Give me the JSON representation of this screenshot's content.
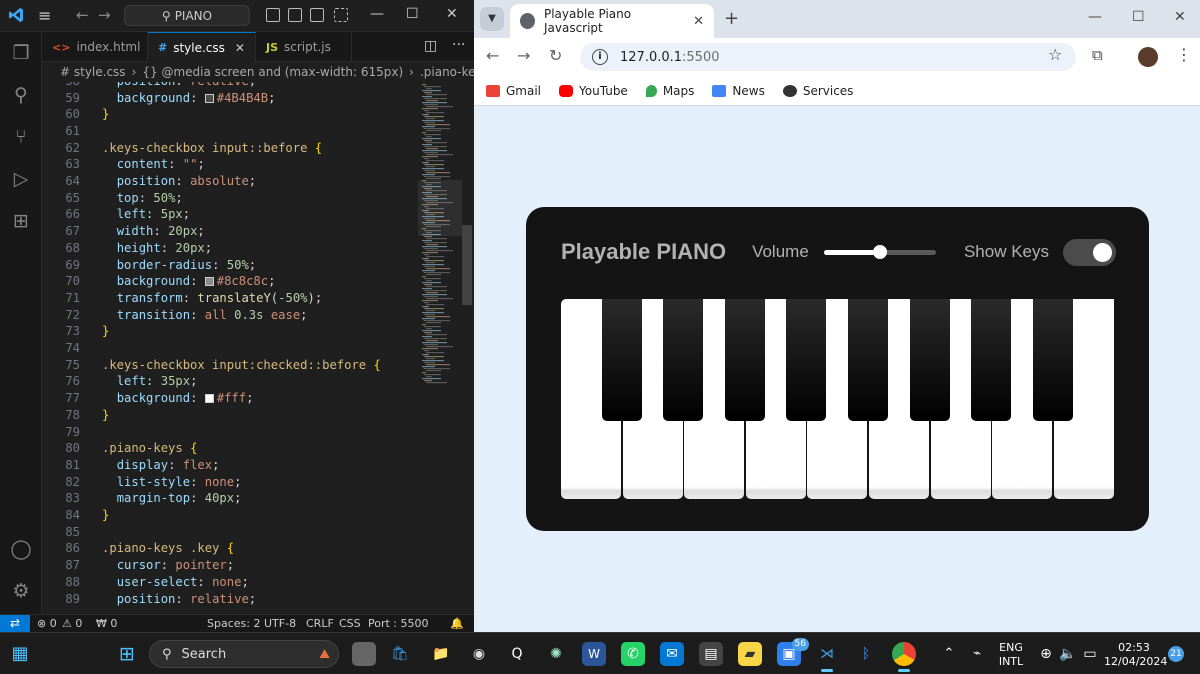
{
  "vscode": {
    "command_center": "PIANO",
    "tabs": [
      {
        "label": "index.html",
        "icon": "<>",
        "icon_color": "#e44d26"
      },
      {
        "label": "style.css",
        "icon": "#",
        "icon_color": "#42a5f5"
      },
      {
        "label": "script.js",
        "icon": "JS",
        "icon_color": "#cbcb41"
      }
    ],
    "breadcrumb": [
      "# style.css",
      "{} @media screen and (max-width: 615px)",
      ".piano-keys .key:nth"
    ],
    "status": {
      "remote": "⇄",
      "errors": "⊗ 0",
      "warnings": "⚠ 0",
      "ports": "₩ 0",
      "spaces": "Spaces: 2",
      "encoding": "UTF-8",
      "eol": "CRLF",
      "language": "CSS",
      "port": "Port : 5500",
      "bell": "🔔"
    }
  },
  "code_lines": [
    {
      "n": "59",
      "html": "  <span class='prop'>background</span>: <span class='cswatch' style='background:#4B4B4B'></span><span class='val'>#4B4B4B</span>;"
    },
    {
      "n": "60",
      "html": "<span class='br'>}</span>"
    },
    {
      "n": "61",
      "html": ""
    },
    {
      "n": "62",
      "html": "<span class='sel'>.keys-checkbox input::before</span> <span class='br'>{</span>"
    },
    {
      "n": "63",
      "html": "  <span class='prop'>content</span>: <span class='val'>\"\"</span>;"
    },
    {
      "n": "64",
      "html": "  <span class='prop'>position</span>: <span class='val'>absolute</span>;"
    },
    {
      "n": "65",
      "html": "  <span class='prop'>top</span>: <span class='num'>50%</span>;"
    },
    {
      "n": "66",
      "html": "  <span class='prop'>left</span>: <span class='num'>5px</span>;"
    },
    {
      "n": "67",
      "html": "  <span class='prop'>width</span>: <span class='num'>20px</span>;"
    },
    {
      "n": "68",
      "html": "  <span class='prop'>height</span>: <span class='num'>20px</span>;"
    },
    {
      "n": "69",
      "html": "  <span class='prop'>border-radius</span>: <span class='num'>50%</span>;"
    },
    {
      "n": "70",
      "html": "  <span class='prop'>background</span>: <span class='cswatch' style='background:#8c8c8c'></span><span class='val'>#8c8c8c</span>;"
    },
    {
      "n": "71",
      "html": "  <span class='prop'>transform</span>: <span class='fn'>translateY</span>(<span class='num'>-50%</span>);"
    },
    {
      "n": "72",
      "html": "  <span class='prop'>transition</span>: <span class='val'>all</span> <span class='num'>0.3s</span> <span class='val'>ease</span>;"
    },
    {
      "n": "73",
      "html": "<span class='br'>}</span>"
    },
    {
      "n": "74",
      "html": ""
    },
    {
      "n": "75",
      "html": "<span class='sel'>.keys-checkbox input:checked::before</span> <span class='br'>{</span>"
    },
    {
      "n": "76",
      "html": "  <span class='prop'>left</span>: <span class='num'>35px</span>;"
    },
    {
      "n": "77",
      "html": "  <span class='prop'>background</span>: <span class='cswatch' style='background:#fff'></span><span class='val'>#fff</span>;"
    },
    {
      "n": "78",
      "html": "<span class='br'>}</span>"
    },
    {
      "n": "79",
      "html": ""
    },
    {
      "n": "80",
      "html": "<span class='sel'>.piano-keys</span> <span class='br'>{</span>"
    },
    {
      "n": "81",
      "html": "  <span class='prop'>display</span>: <span class='val'>flex</span>;"
    },
    {
      "n": "82",
      "html": "  <span class='prop'>list-style</span>: <span class='val'>none</span>;"
    },
    {
      "n": "83",
      "html": "  <span class='prop'>margin-top</span>: <span class='num'>40px</span>;"
    },
    {
      "n": "84",
      "html": "<span class='br'>}</span>"
    },
    {
      "n": "85",
      "html": ""
    },
    {
      "n": "86",
      "html": "<span class='sel'>.piano-keys .key</span> <span class='br'>{</span>"
    },
    {
      "n": "87",
      "html": "  <span class='prop'>cursor</span>: <span class='val'>pointer</span>;"
    },
    {
      "n": "88",
      "html": "  <span class='prop'>user-select</span>: <span class='val'>none</span>;"
    },
    {
      "n": "89",
      "html": "  <span class='prop'>position</span>: <span class='val'>relative</span>;"
    }
  ],
  "chrome": {
    "tab_title": "Playable Piano Javascript",
    "url_host": "127.0.0.1",
    "url_port": ":5500",
    "bookmarks": [
      {
        "label": "Gmail",
        "color": "#ea4335"
      },
      {
        "label": "YouTube",
        "color": "#ff0000"
      },
      {
        "label": "Maps",
        "color": "#34a853"
      },
      {
        "label": "News",
        "color": "#4285f4"
      },
      {
        "label": "Services",
        "color": "#333333"
      }
    ]
  },
  "piano": {
    "title": "Playable PIANO",
    "volume_label": "Volume",
    "volume_level": 0.5,
    "show_keys_label": "Show Keys",
    "show_keys_on": true,
    "white_keys": 9,
    "black_keys": 8
  },
  "taskbar": {
    "search_placeholder": "Search",
    "badge_count": "56",
    "lang_top": "ENG",
    "lang_bottom": "INTL",
    "time": "02:53",
    "date": "12/04/2024",
    "notif_count": "21"
  }
}
